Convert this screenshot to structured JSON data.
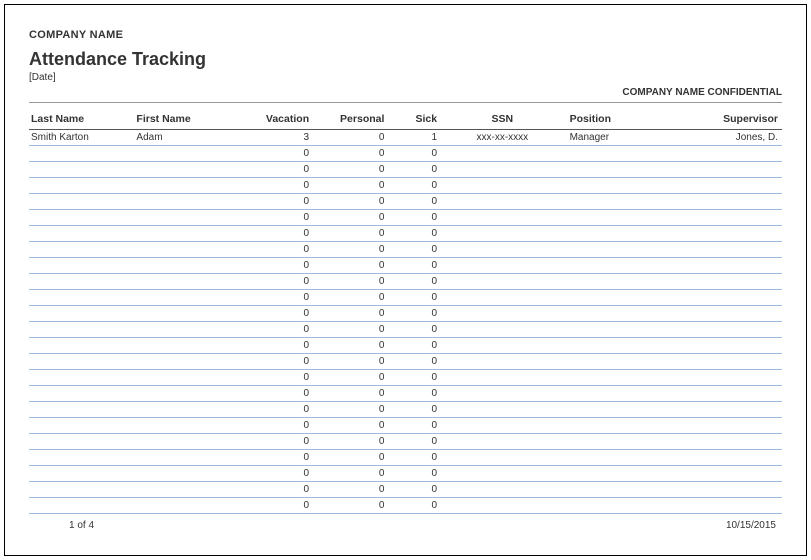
{
  "header": {
    "company": "COMPANY NAME",
    "title": "Attendance Tracking",
    "date_placeholder": "[Date]",
    "confidential": "COMPANY NAME CONFIDENTIAL"
  },
  "columns": {
    "last_name": "Last Name",
    "first_name": "First Name",
    "vacation": "Vacation",
    "personal": "Personal",
    "sick": "Sick",
    "ssn": "SSN",
    "position": "Position",
    "supervisor": "Supervisor"
  },
  "rows": [
    {
      "last_name": "Smith Karton",
      "first_name": "Adam",
      "vacation": "3",
      "personal": "0",
      "sick": "1",
      "ssn": "xxx-xx-xxxx",
      "position": "Manager",
      "supervisor": "Jones, D."
    },
    {
      "last_name": "",
      "first_name": "",
      "vacation": "0",
      "personal": "0",
      "sick": "0",
      "ssn": "",
      "position": "",
      "supervisor": ""
    },
    {
      "last_name": "",
      "first_name": "",
      "vacation": "0",
      "personal": "0",
      "sick": "0",
      "ssn": "",
      "position": "",
      "supervisor": ""
    },
    {
      "last_name": "",
      "first_name": "",
      "vacation": "0",
      "personal": "0",
      "sick": "0",
      "ssn": "",
      "position": "",
      "supervisor": ""
    },
    {
      "last_name": "",
      "first_name": "",
      "vacation": "0",
      "personal": "0",
      "sick": "0",
      "ssn": "",
      "position": "",
      "supervisor": ""
    },
    {
      "last_name": "",
      "first_name": "",
      "vacation": "0",
      "personal": "0",
      "sick": "0",
      "ssn": "",
      "position": "",
      "supervisor": ""
    },
    {
      "last_name": "",
      "first_name": "",
      "vacation": "0",
      "personal": "0",
      "sick": "0",
      "ssn": "",
      "position": "",
      "supervisor": ""
    },
    {
      "last_name": "",
      "first_name": "",
      "vacation": "0",
      "personal": "0",
      "sick": "0",
      "ssn": "",
      "position": "",
      "supervisor": ""
    },
    {
      "last_name": "",
      "first_name": "",
      "vacation": "0",
      "personal": "0",
      "sick": "0",
      "ssn": "",
      "position": "",
      "supervisor": ""
    },
    {
      "last_name": "",
      "first_name": "",
      "vacation": "0",
      "personal": "0",
      "sick": "0",
      "ssn": "",
      "position": "",
      "supervisor": ""
    },
    {
      "last_name": "",
      "first_name": "",
      "vacation": "0",
      "personal": "0",
      "sick": "0",
      "ssn": "",
      "position": "",
      "supervisor": ""
    },
    {
      "last_name": "",
      "first_name": "",
      "vacation": "0",
      "personal": "0",
      "sick": "0",
      "ssn": "",
      "position": "",
      "supervisor": ""
    },
    {
      "last_name": "",
      "first_name": "",
      "vacation": "0",
      "personal": "0",
      "sick": "0",
      "ssn": "",
      "position": "",
      "supervisor": ""
    },
    {
      "last_name": "",
      "first_name": "",
      "vacation": "0",
      "personal": "0",
      "sick": "0",
      "ssn": "",
      "position": "",
      "supervisor": ""
    },
    {
      "last_name": "",
      "first_name": "",
      "vacation": "0",
      "personal": "0",
      "sick": "0",
      "ssn": "",
      "position": "",
      "supervisor": ""
    },
    {
      "last_name": "",
      "first_name": "",
      "vacation": "0",
      "personal": "0",
      "sick": "0",
      "ssn": "",
      "position": "",
      "supervisor": ""
    },
    {
      "last_name": "",
      "first_name": "",
      "vacation": "0",
      "personal": "0",
      "sick": "0",
      "ssn": "",
      "position": "",
      "supervisor": ""
    },
    {
      "last_name": "",
      "first_name": "",
      "vacation": "0",
      "personal": "0",
      "sick": "0",
      "ssn": "",
      "position": "",
      "supervisor": ""
    },
    {
      "last_name": "",
      "first_name": "",
      "vacation": "0",
      "personal": "0",
      "sick": "0",
      "ssn": "",
      "position": "",
      "supervisor": ""
    },
    {
      "last_name": "",
      "first_name": "",
      "vacation": "0",
      "personal": "0",
      "sick": "0",
      "ssn": "",
      "position": "",
      "supervisor": ""
    },
    {
      "last_name": "",
      "first_name": "",
      "vacation": "0",
      "personal": "0",
      "sick": "0",
      "ssn": "",
      "position": "",
      "supervisor": ""
    },
    {
      "last_name": "",
      "first_name": "",
      "vacation": "0",
      "personal": "0",
      "sick": "0",
      "ssn": "",
      "position": "",
      "supervisor": ""
    },
    {
      "last_name": "",
      "first_name": "",
      "vacation": "0",
      "personal": "0",
      "sick": "0",
      "ssn": "",
      "position": "",
      "supervisor": ""
    },
    {
      "last_name": "",
      "first_name": "",
      "vacation": "0",
      "personal": "0",
      "sick": "0",
      "ssn": "",
      "position": "",
      "supervisor": ""
    }
  ],
  "footer": {
    "page": "1 of 4",
    "date": "10/15/2015"
  },
  "chart_data": {
    "type": "table",
    "title": "Attendance Tracking",
    "columns": [
      "Last Name",
      "First Name",
      "Vacation",
      "Personal",
      "Sick",
      "SSN",
      "Position",
      "Supervisor"
    ],
    "rows": [
      [
        "Smith Karton",
        "Adam",
        3,
        0,
        1,
        "xxx-xx-xxxx",
        "Manager",
        "Jones, D."
      ],
      [
        "",
        "",
        0,
        0,
        0,
        "",
        "",
        ""
      ],
      [
        "",
        "",
        0,
        0,
        0,
        "",
        "",
        ""
      ],
      [
        "",
        "",
        0,
        0,
        0,
        "",
        "",
        ""
      ],
      [
        "",
        "",
        0,
        0,
        0,
        "",
        "",
        ""
      ],
      [
        "",
        "",
        0,
        0,
        0,
        "",
        "",
        ""
      ],
      [
        "",
        "",
        0,
        0,
        0,
        "",
        "",
        ""
      ],
      [
        "",
        "",
        0,
        0,
        0,
        "",
        "",
        ""
      ],
      [
        "",
        "",
        0,
        0,
        0,
        "",
        "",
        ""
      ],
      [
        "",
        "",
        0,
        0,
        0,
        "",
        "",
        ""
      ],
      [
        "",
        "",
        0,
        0,
        0,
        "",
        "",
        ""
      ],
      [
        "",
        "",
        0,
        0,
        0,
        "",
        "",
        ""
      ],
      [
        "",
        "",
        0,
        0,
        0,
        "",
        "",
        ""
      ],
      [
        "",
        "",
        0,
        0,
        0,
        "",
        "",
        ""
      ],
      [
        "",
        "",
        0,
        0,
        0,
        "",
        "",
        ""
      ],
      [
        "",
        "",
        0,
        0,
        0,
        "",
        "",
        ""
      ],
      [
        "",
        "",
        0,
        0,
        0,
        "",
        "",
        ""
      ],
      [
        "",
        "",
        0,
        0,
        0,
        "",
        "",
        ""
      ],
      [
        "",
        "",
        0,
        0,
        0,
        "",
        "",
        ""
      ],
      [
        "",
        "",
        0,
        0,
        0,
        "",
        "",
        ""
      ],
      [
        "",
        "",
        0,
        0,
        0,
        "",
        "",
        ""
      ],
      [
        "",
        "",
        0,
        0,
        0,
        "",
        "",
        ""
      ],
      [
        "",
        "",
        0,
        0,
        0,
        "",
        "",
        ""
      ],
      [
        "",
        "",
        0,
        0,
        0,
        "",
        "",
        ""
      ]
    ]
  }
}
